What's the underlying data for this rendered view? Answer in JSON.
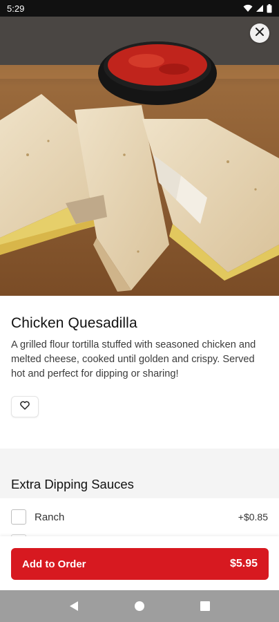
{
  "status_bar": {
    "time": "5:29"
  },
  "hero": {
    "image_alt": "chicken-quesadilla-photo"
  },
  "item": {
    "title": "Chicken Quesadilla",
    "description": "A grilled flour tortilla stuffed with seasoned chicken and melted cheese, cooked until golden and crispy. Served hot and perfect for dipping or sharing!"
  },
  "favorite": {
    "icon": "heart-icon",
    "active": false
  },
  "sauces": {
    "title": "Extra Dipping Sauces",
    "options": [
      {
        "label": "Ranch",
        "price": "+$0.85",
        "checked": false
      }
    ]
  },
  "order": {
    "label": "Add to Order",
    "price": "$5.95"
  },
  "colors": {
    "accent": "#d71920",
    "nav_bar": "#9e9e9e",
    "status_bar": "#111111"
  }
}
